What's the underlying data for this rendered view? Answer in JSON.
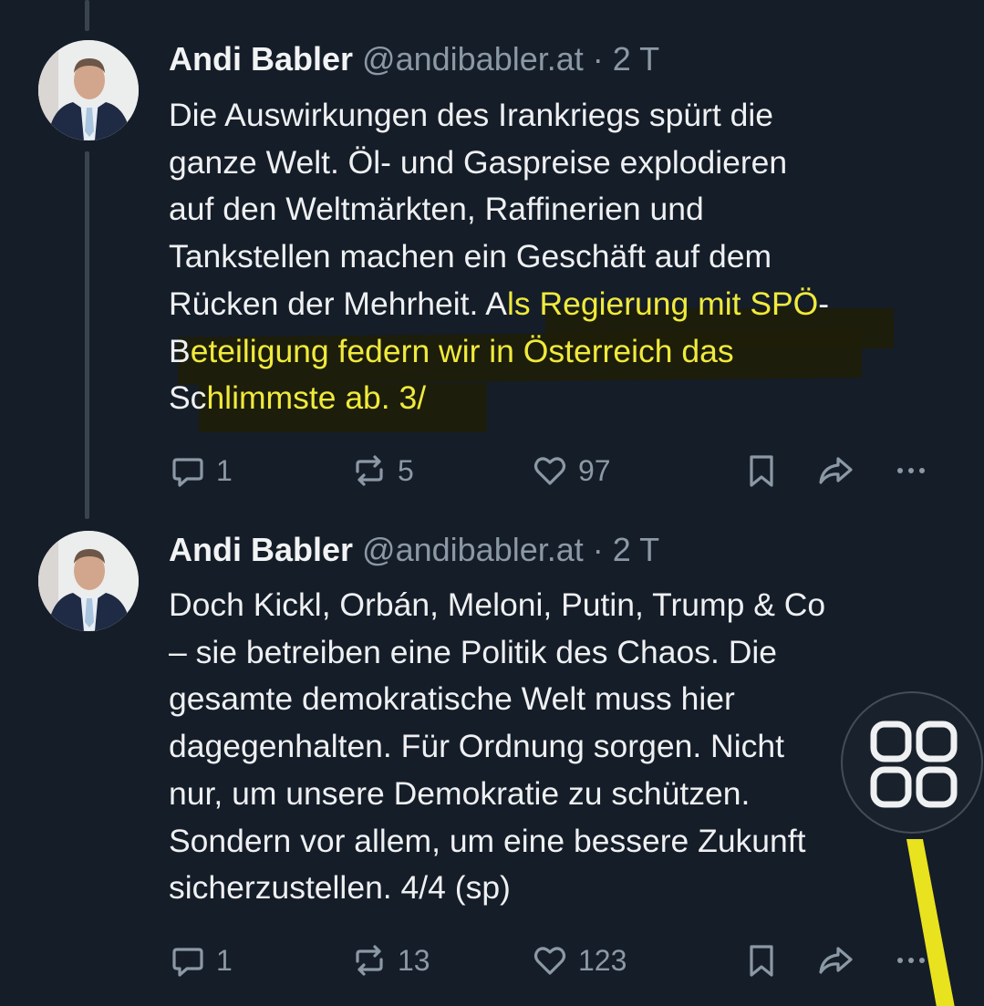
{
  "colors": {
    "background": "#151d28",
    "text": "#eef0f2",
    "muted": "#8b98a5",
    "highlight": "#f0ea3c"
  },
  "tweets": [
    {
      "name": "Andi Babler",
      "handle": "@andibabler.at",
      "separator": "·",
      "time": "2 T",
      "text_lines": [
        "Die Auswirkungen des Irankriegs spürt die",
        "ganze Welt. Öl- und Gaspreise explodieren",
        "auf den Weltmärkten, Raffinerien und",
        "Tankstellen machen ein Geschäft auf dem"
      ],
      "line5_plain": "Rücken der Mehrheit. A",
      "line5_highlight": "ls Regierung mit SPÖ",
      "line5_tail": "-",
      "line6_plain": "B",
      "line6_highlight": "eteiligung federn wir in Österreich das",
      "line7_plain": "Sc",
      "line7_highlight": "hlimmste ab. 3/",
      "actions": {
        "reply_icon": "reply-icon",
        "reply_count": "1",
        "repost_icon": "repost-icon",
        "repost_count": "5",
        "like_icon": "heart-icon",
        "like_count": "97",
        "bookmark_icon": "bookmark-icon",
        "share_icon": "share-icon",
        "more_icon": "more-icon"
      }
    },
    {
      "name": "Andi Babler",
      "handle": "@andibabler.at",
      "separator": "·",
      "time": "2 T",
      "text_lines": [
        "Doch Kickl, Orbán, Meloni, Putin, Trump & Co",
        "– sie betreiben eine Politik des Chaos. Die",
        "gesamte demokratische Welt muss hier",
        "dagegenhalten. Für Ordnung sorgen. Nicht",
        "nur, um unsere Demokratie zu schützen.",
        "Sondern vor allem, um eine bessere Zukunft",
        "sicherzustellen. 4/4 (sp)"
      ],
      "actions": {
        "reply_icon": "reply-icon",
        "reply_count": "1",
        "repost_icon": "repost-icon",
        "repost_count": "13",
        "like_icon": "heart-icon",
        "like_count": "123",
        "bookmark_icon": "bookmark-icon",
        "share_icon": "share-icon",
        "more_icon": "more-icon"
      }
    }
  ],
  "overlay": {
    "icon": "app-grid-icon"
  }
}
